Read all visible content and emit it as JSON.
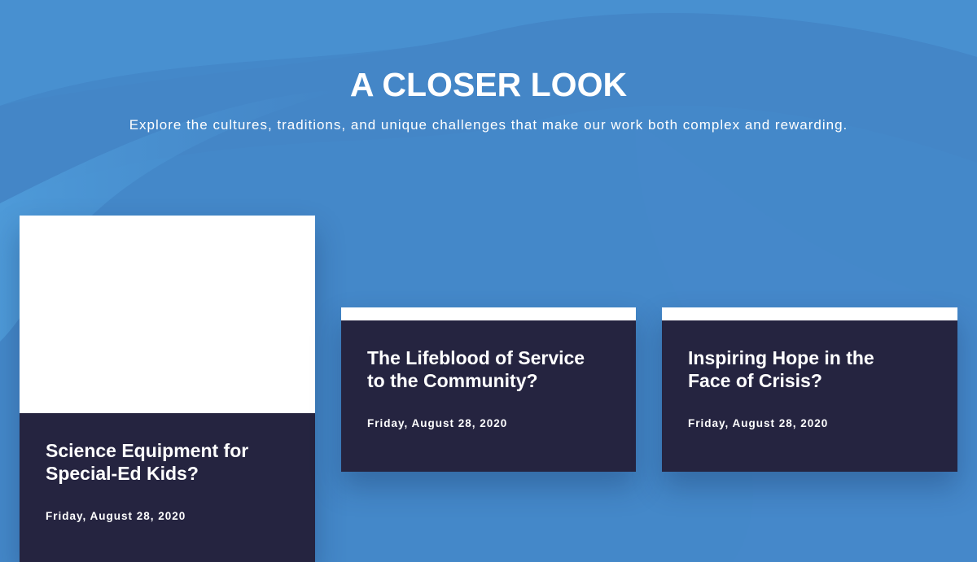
{
  "section": {
    "title": "A CLOSER LOOK",
    "subtitle": "Explore the cultures, traditions, and unique challenges that make our work both complex and rewarding."
  },
  "cards": [
    {
      "title_line1": "Science Equipment for",
      "title_line2": "Special-Ed Kids?",
      "date": "Friday, August 28, 2020"
    },
    {
      "title_line1": "The Lifeblood of Service",
      "title_line2": "to the Community?",
      "date": "Friday, August 28, 2020"
    },
    {
      "title_line1": "Inspiring Hope in the",
      "title_line2": "Face of Crisis?",
      "date": "Friday, August 28, 2020"
    }
  ],
  "colors": {
    "background": "#4488c9",
    "card_body": "#252440",
    "card_image": "#ffffff",
    "text": "#ffffff"
  }
}
